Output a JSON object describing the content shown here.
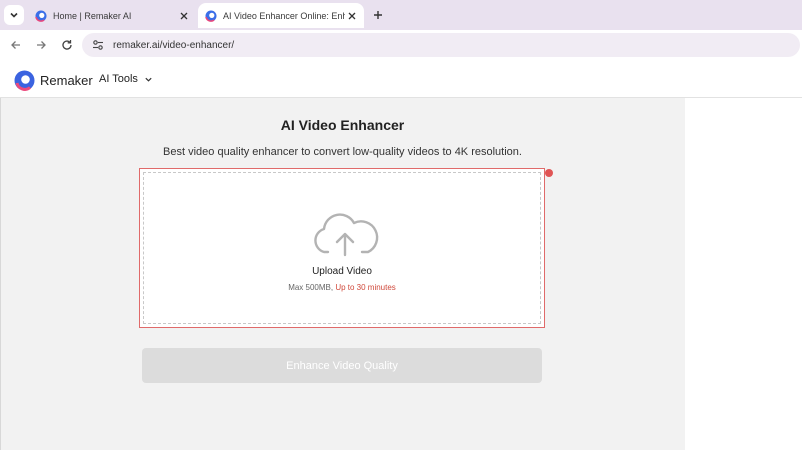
{
  "browser": {
    "tabs": [
      {
        "title": "Home | Remaker AI",
        "active": false
      },
      {
        "title": "AI Video Enhancer Online: Enhance",
        "active": true
      }
    ],
    "url": "remaker.ai/video-enhancer/"
  },
  "site": {
    "brand": "Remaker",
    "nav_label": "AI Tools"
  },
  "main": {
    "title": "AI Video Enhancer",
    "subtitle": "Best video quality enhancer to convert low-quality videos to 4K resolution.",
    "upload": {
      "label": "Upload Video",
      "size_limit": "Max 500MB,",
      "duration_limit": "Up to 30 minutes"
    },
    "enhance_button": "Enhance Video Quality"
  },
  "colors": {
    "tabstrip": "#e9e1ef",
    "accent_red": "#d0493b",
    "disabled_button": "#dcdcdc"
  }
}
